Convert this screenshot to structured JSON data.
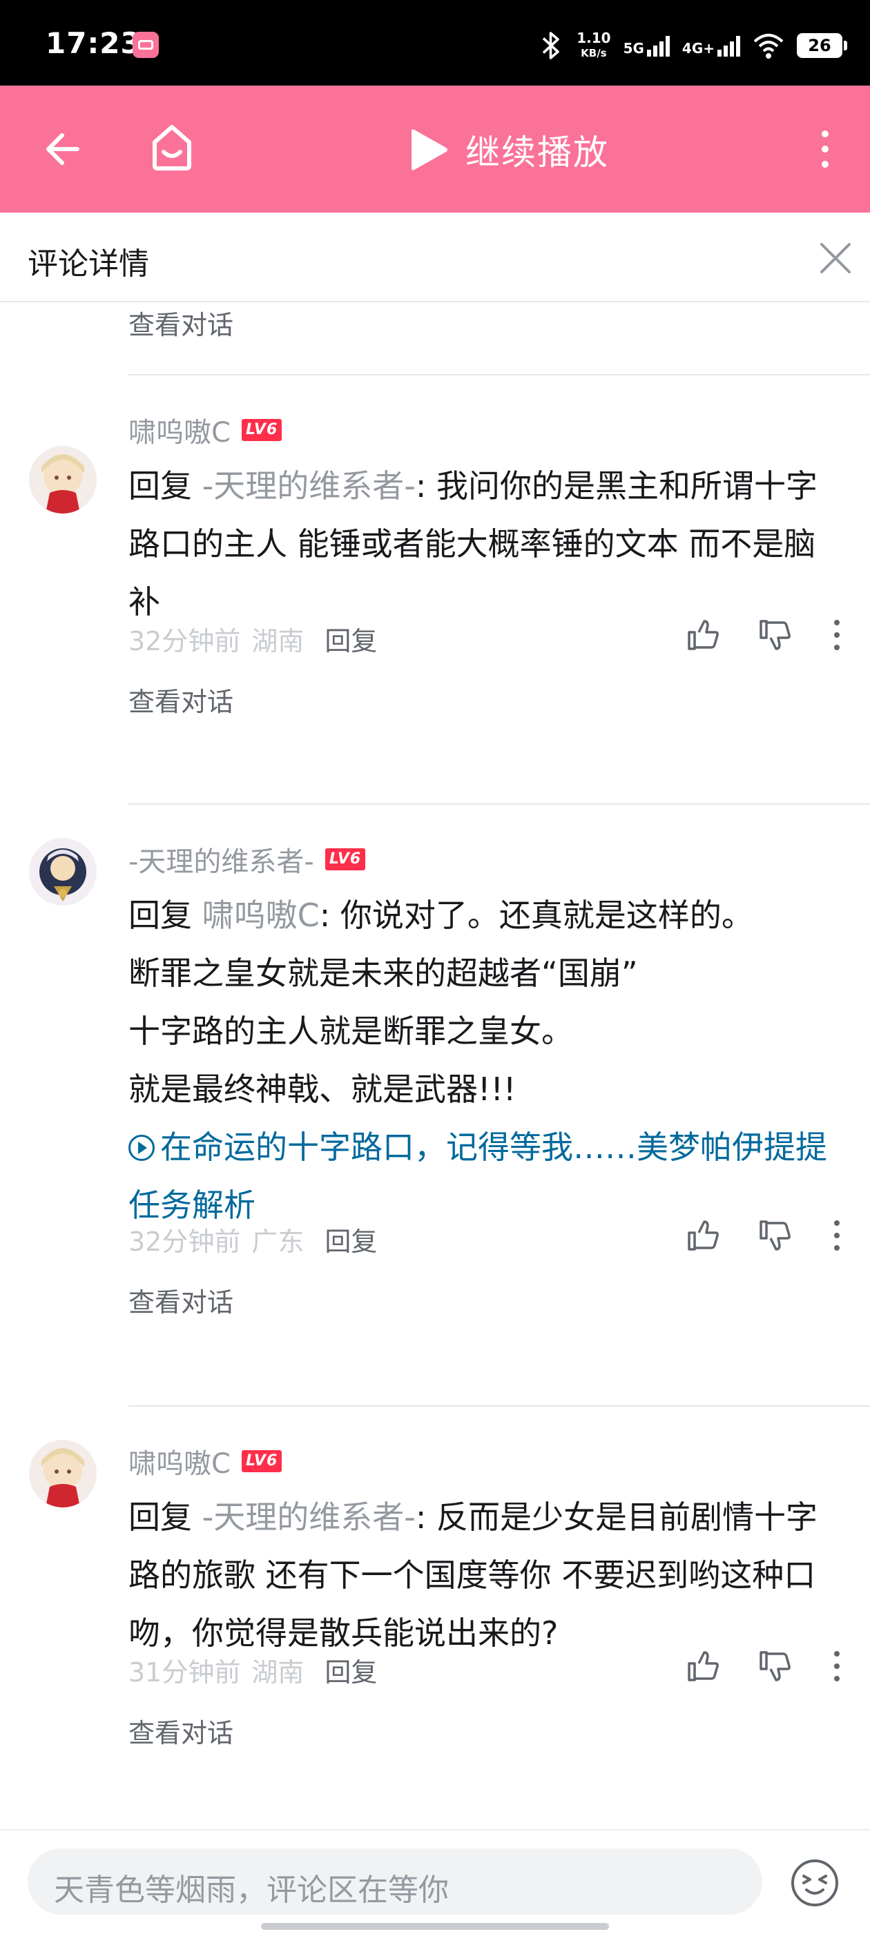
{
  "status_bar": {
    "time": "17:23",
    "net_speed": "1.10",
    "net_speed_unit": "KB/s",
    "sig1": "5G",
    "sig2": "4G+",
    "battery": "26"
  },
  "header": {
    "play_label": "继续播放"
  },
  "detail": {
    "title": "评论详情"
  },
  "partial_link": "查看对话",
  "comments": [
    {
      "user": "啸呜嗷C",
      "level": "LV6",
      "reply_prefix": "回复 ",
      "reply_to": "-天理的维系者-",
      "text": ": 我问你的是黑主和所谓十字路口的主人 能锤或者能大概率锤的文本 而不是脑补",
      "time": "32分钟前",
      "location": "湖南",
      "reply_label": "回复",
      "view_conversation": "查看对话"
    },
    {
      "user": "-天理的维系者-",
      "level": "LV6",
      "reply_prefix": "回复 ",
      "reply_to": "啸呜嗷C",
      "text_lines": [
        ": 你说对了。还真就是这样的。",
        "断罪之皇女就是未来的超越者“国崩”",
        "十字路的主人就是断罪之皇女。",
        "就是最终神戟、就是武器!!!"
      ],
      "link_text": "在命运的十字路口，记得等我……美梦帕伊提提任务解析",
      "time": "32分钟前",
      "location": "广东",
      "reply_label": "回复",
      "view_conversation": "查看对话"
    },
    {
      "user": "啸呜嗷C",
      "level": "LV6",
      "reply_prefix": "回复 ",
      "reply_to": "-天理的维系者-",
      "text": ": 反而是少女是目前剧情十字路的旅歌 还有下一个国度等你   不要迟到哟这种口吻，你觉得是散兵能说出来的?",
      "time": "31分钟前",
      "location": "湖南",
      "reply_label": "回复",
      "view_conversation": "查看对话"
    }
  ],
  "input": {
    "placeholder": "天青色等烟雨，评论区在等你"
  },
  "colors": {
    "brand_pink": "#fb7299",
    "level_badge": "#ff2e4a",
    "link_blue": "#00699d",
    "muted_gray": "#9499a0"
  },
  "icons": [
    "back-arrow-icon",
    "home-tv-icon",
    "play-icon",
    "more-vertical-icon",
    "close-icon",
    "like-icon",
    "dislike-icon",
    "more-dots-icon",
    "emoji-icon"
  ]
}
